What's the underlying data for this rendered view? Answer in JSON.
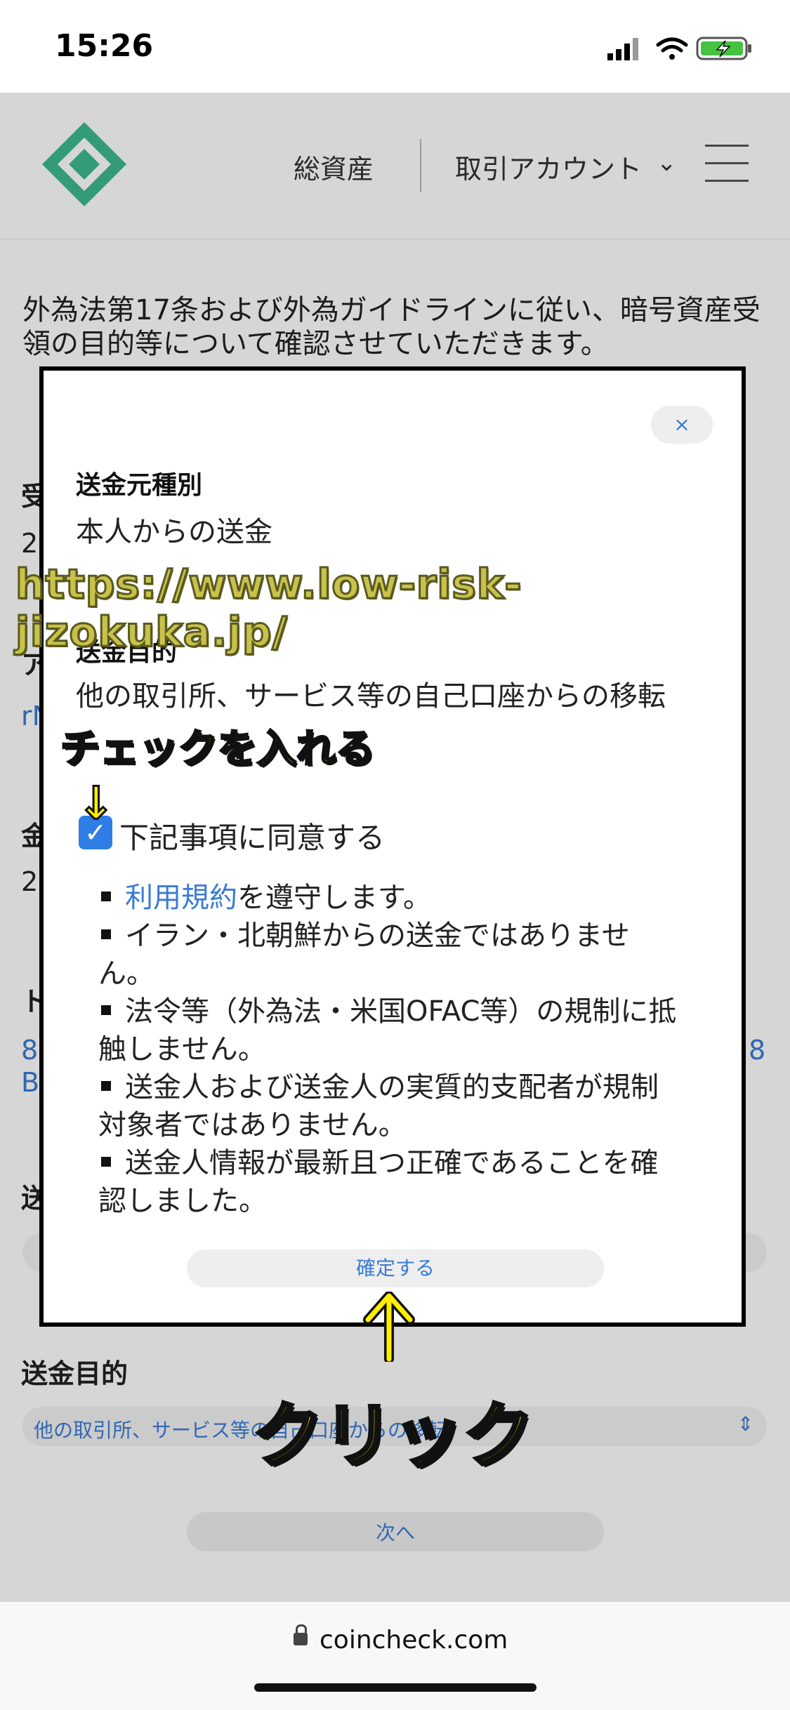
{
  "status_bar": {
    "time": "15:26"
  },
  "header": {
    "nav_assets": "総資産",
    "nav_account": "取引アカウント"
  },
  "intro": {
    "text": "外為法第17条および外為ガイドラインに従い、暗号資産受領の目的等について確認させていただきます。"
  },
  "background": {
    "fragments": [
      "受",
      "2",
      "ア",
      "金",
      "2",
      "ト",
      "送"
    ],
    "link_fragments": [
      "rN",
      "8",
      "B",
      "8"
    ],
    "purpose_label": "送金目的",
    "purpose_select_value": "他の取引所、サービス等の自己口座からの移転",
    "next_label": "次へ"
  },
  "modal": {
    "close_label": "×",
    "source_type_label": "送金元種別",
    "source_type_value": "本人からの送金",
    "purpose_label": "送金目的",
    "purpose_value": "他の取引所、サービス等の自己口座からの移転",
    "agree_label": "下記事項に同意する",
    "agree_checked": true,
    "rules": [
      {
        "link": "利用規約",
        "text": "を遵守します。"
      },
      {
        "link": "",
        "text": "イラン・北朝鮮からの送金ではありません。"
      },
      {
        "link": "",
        "text": "法令等（外為法・米国OFAC等）の規制に抵触しません。"
      },
      {
        "link": "",
        "text": "送金人および送金人の実質的支配者が規制対象者ではありません。"
      },
      {
        "link": "",
        "text": "送金人情報が最新且つ正確であることを確認しました。"
      }
    ],
    "confirm_label": "確定する"
  },
  "annotations": {
    "watermark": "https://www.low-risk-jizokuka.jp/",
    "check_callout": "チェックを入れる",
    "check_arrow": "↓",
    "click_callout": "クリック"
  },
  "url_bar": {
    "domain": "coincheck.com"
  },
  "colors": {
    "brand_green": "#3fb98f",
    "link_blue": "#3a7bd5",
    "checkbox_blue": "#2f7ee6",
    "callout_yellow": "#ffee00"
  }
}
